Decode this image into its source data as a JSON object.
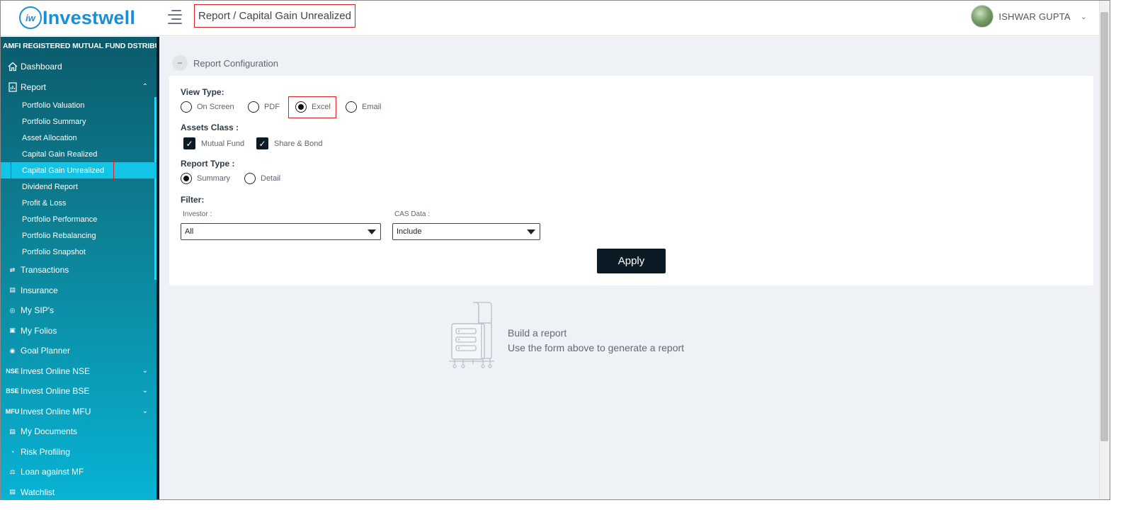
{
  "header": {
    "logo_mark": "iw",
    "logo_text": "Investwell",
    "breadcrumb": "Report / Capital Gain Unrealized",
    "user_name": "ISHWAR GUPTA"
  },
  "sidebar": {
    "distributor_tag": "AMFI REGISTERED MUTUAL FUND DSTRIBUTOR",
    "items_top": [
      {
        "label": "Dashboard",
        "icon": "home-icon"
      },
      {
        "label": "Report",
        "icon": "report-icon"
      }
    ],
    "report_subitems": [
      "Portfolio Valuation",
      "Portfolio Summary",
      "Asset Allocation",
      "Capital Gain Realized",
      "Capital Gain Unrealized",
      "Dividend Report",
      "Profit & Loss",
      "Portfolio Performance",
      "Portfolio Rebalancing",
      "Portfolio Snapshot"
    ],
    "active_subitem": "Capital Gain Unrealized",
    "items_bottom": [
      {
        "label": "Transactions",
        "icon": "transfer-arrows-icon",
        "glyph": "⇄"
      },
      {
        "label": "Insurance",
        "icon": "document-icon",
        "glyph": "▤"
      },
      {
        "label": "My SIP's",
        "icon": "sip-icon",
        "glyph": "◎"
      },
      {
        "label": "My Folios",
        "icon": "folio-icon",
        "glyph": "▣"
      },
      {
        "label": "Goal Planner",
        "icon": "target-icon",
        "glyph": "◉"
      },
      {
        "label": "Invest Online NSE",
        "icon": "nse-icon",
        "glyph": "NSE",
        "expandable": true
      },
      {
        "label": "Invest Online BSE",
        "icon": "bse-icon",
        "glyph": "BSE",
        "expandable": true
      },
      {
        "label": "Invest Online MFU",
        "icon": "mfu-icon",
        "glyph": "MFU",
        "expandable": true
      },
      {
        "label": "My Documents",
        "icon": "documents-icon",
        "glyph": "▤"
      },
      {
        "label": "Risk Profiling",
        "icon": "gauge-icon",
        "glyph": "◔"
      },
      {
        "label": "Loan against MF",
        "icon": "loan-icon",
        "glyph": "⚖"
      },
      {
        "label": "Watchlist",
        "icon": "watchlist-icon",
        "glyph": "▤"
      }
    ]
  },
  "config": {
    "title": "Report Configuration",
    "collapse_glyph": "−",
    "view_type_label": "View Type:",
    "view_types": [
      "On Screen",
      "PDF",
      "Excel",
      "Email"
    ],
    "view_type_selected": "Excel",
    "assets_class_label": "Assets Class :",
    "assets": [
      "Mutual Fund",
      "Share & Bond"
    ],
    "report_type_label": "Report Type :",
    "report_types": [
      "Summary",
      "Detail"
    ],
    "report_type_selected": "Summary",
    "filter_label": "Filter:",
    "investor_label": "Investor :",
    "investor_value": "All",
    "cas_label": "CAS Data :",
    "cas_value": "Include",
    "apply_label": "Apply"
  },
  "empty_state": {
    "title": "Build a report",
    "subtitle": "Use the form above to generate a report",
    "icon": "report-builder-illustration"
  },
  "colors": {
    "brand": "#1a8fd6",
    "sidebar_top": "#0b5b6c",
    "sidebar_bottom": "#08b3d4",
    "active_item": "#12c4e6",
    "primary_button": "#0a1b26",
    "highlight_box": "#e02020"
  }
}
